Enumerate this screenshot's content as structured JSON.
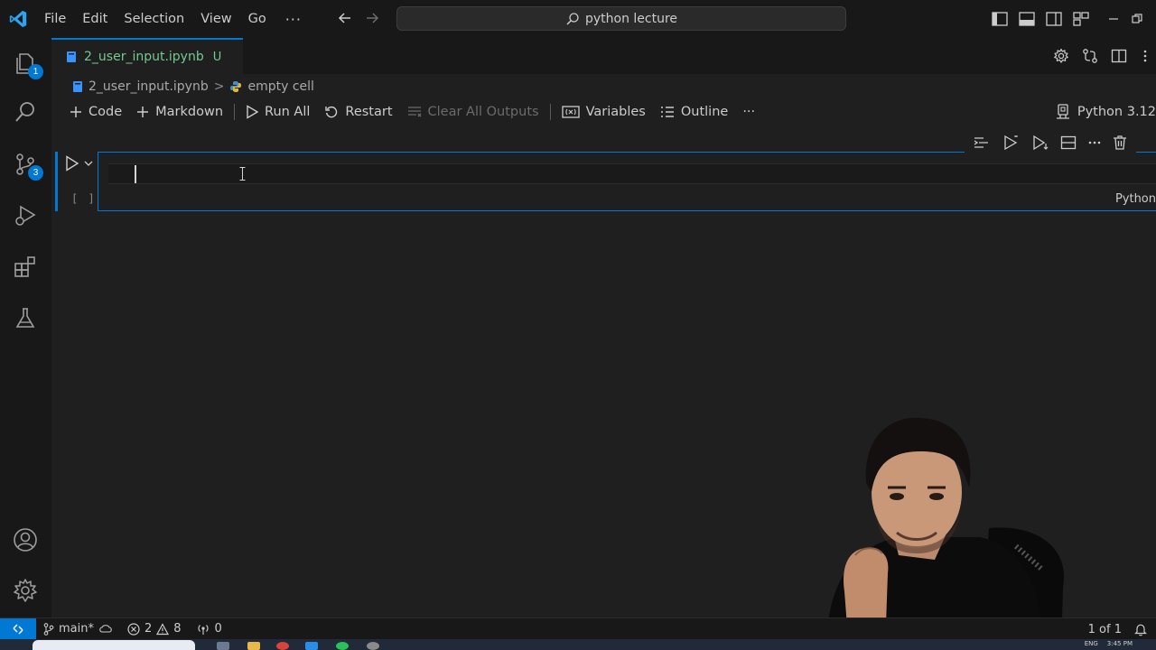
{
  "menu": {
    "items": [
      "File",
      "Edit",
      "Selection",
      "View",
      "Go"
    ],
    "more": "···"
  },
  "command_center": {
    "text": "python lecture",
    "icon": "search-icon"
  },
  "tab": {
    "name": "2_user_input.ipynb",
    "status": "U"
  },
  "breadcrumb": {
    "file": "2_user_input.ipynb",
    "separator": ">",
    "cell": "empty cell"
  },
  "toolbar": {
    "code": "Code",
    "markdown": "Markdown",
    "run_all": "Run All",
    "restart": "Restart",
    "clear_outputs": "Clear All Outputs",
    "variables": "Variables",
    "outline": "Outline",
    "more": "···"
  },
  "kernel": {
    "label": "Python 3.12"
  },
  "cell": {
    "execution_count": "[ ]",
    "language": "Python"
  },
  "activity": {
    "explorer_badge": "1",
    "scm_badge": "3"
  },
  "statusbar": {
    "branch": "main*",
    "errors": "2",
    "warnings": "8",
    "ports": "0",
    "position": "1 of 1"
  },
  "taskbar": {
    "lang": "ENG",
    "time": "3:45 PM"
  },
  "colors": {
    "accent": "#0078d4",
    "modified_file": "#73c991",
    "background": "#1f1f1f",
    "chrome": "#181818"
  }
}
